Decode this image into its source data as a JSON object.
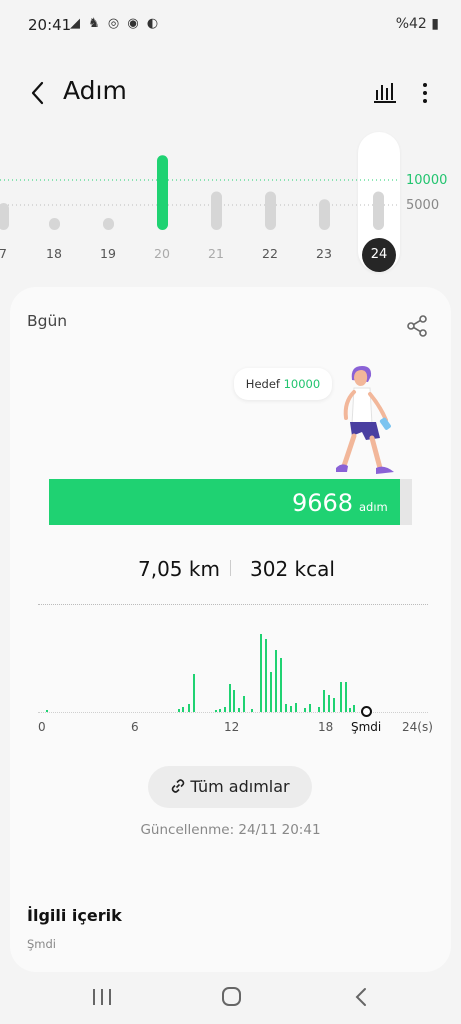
{
  "status_bar": {
    "time": "20:41",
    "notif_icons": "◢ ♞ ◎ ◉ ◐",
    "right": "%42"
  },
  "header": {
    "title": "Adım"
  },
  "week": {
    "days": [
      "7",
      "18",
      "19",
      "20",
      "21",
      "22",
      "23",
      "24"
    ],
    "today": "24",
    "goal_label": "10000",
    "mid_label": "5000",
    "bar_fractions": [
      0.35,
      0.12,
      0.12,
      0.97,
      0.5,
      0.5,
      0.4,
      0.5
    ]
  },
  "card": {
    "title": "Bgün",
    "goal_text": "Hedef",
    "goal_value": "10000",
    "steps": "9668",
    "steps_unit": "adım",
    "progress": 0.967,
    "distance": "7,05 km",
    "calories": "302 kcal",
    "hour_labels": [
      "0",
      "6",
      "12",
      "18",
      "Şmdi",
      "24(s)"
    ],
    "all_steps_button": "Tüm adımlar",
    "updated": "Güncellenme: 24/11 20:41"
  },
  "related": {
    "title": "İlgili içerik",
    "subtitle": "Şmdi"
  },
  "colors": {
    "accent": "#1fd272",
    "bar_gray": "#d6d6d6",
    "dark": "#262626"
  }
}
